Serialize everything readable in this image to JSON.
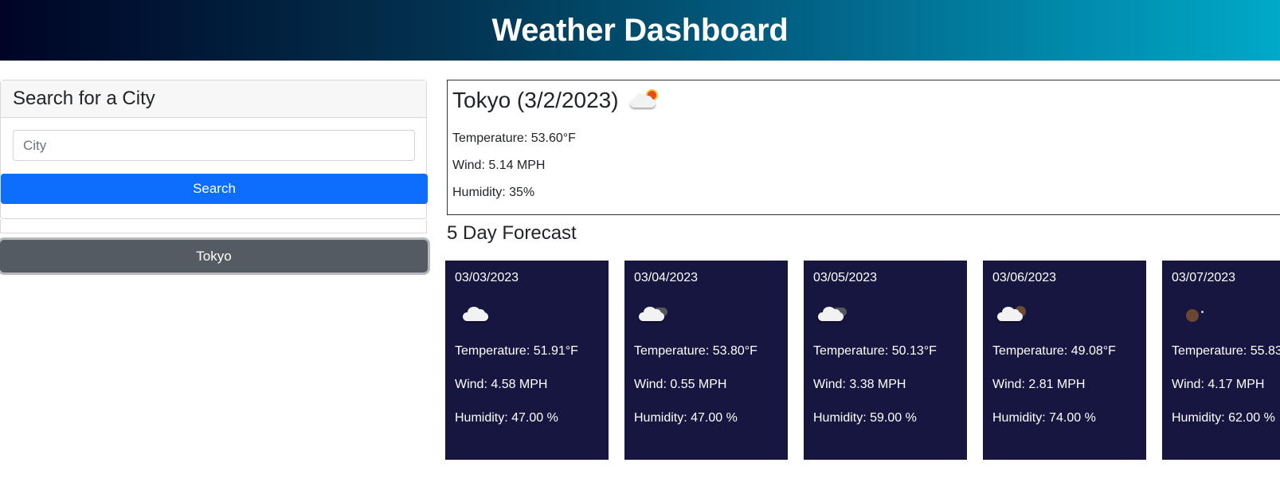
{
  "header": {
    "title": "Weather Dashboard"
  },
  "sidebar": {
    "heading": "Search for a City",
    "input_placeholder": "City",
    "input_value": "",
    "search_label": "Search",
    "history": [
      "Tokyo"
    ]
  },
  "current": {
    "title": "Tokyo (3/2/2023)",
    "icon": "cloud-sun-icon",
    "temperature": "Temperature: 53.60°F",
    "wind": "Wind: 5.14 MPH",
    "humidity": "Humidity: 35%"
  },
  "forecast": {
    "heading": "5 Day Forecast",
    "days": [
      {
        "date": "03/03/2023",
        "icon": "cloud-icon",
        "temperature": "Temperature: 51.91°F",
        "wind": "Wind: 4.58 MPH",
        "humidity": "Humidity: 47.00 %"
      },
      {
        "date": "03/04/2023",
        "icon": "cloud-night-icon",
        "temperature": "Temperature: 53.80°F",
        "wind": "Wind: 0.55 MPH",
        "humidity": "Humidity: 47.00 %"
      },
      {
        "date": "03/05/2023",
        "icon": "cloud-night-icon",
        "temperature": "Temperature: 50.13°F",
        "wind": "Wind: 3.38 MPH",
        "humidity": "Humidity: 59.00 %"
      },
      {
        "date": "03/06/2023",
        "icon": "cloud-moon-icon",
        "temperature": "Temperature: 49.08°F",
        "wind": "Wind: 2.81 MPH",
        "humidity": "Humidity: 74.00 %"
      },
      {
        "date": "03/07/2023",
        "icon": "moon-icon",
        "temperature": "Temperature: 55.83",
        "wind": "Wind: 4.17 MPH",
        "humidity": "Humidity: 62.00 %"
      }
    ]
  },
  "colors": {
    "header_start": "#000425",
    "header_end": "#00a9c8",
    "search_button": "#0d6efd",
    "history_button": "#545b62",
    "forecast_card": "#171640"
  }
}
